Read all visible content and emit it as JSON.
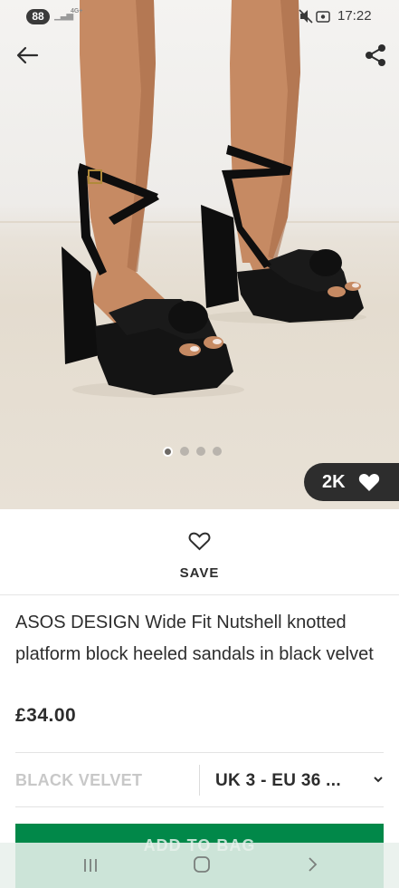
{
  "status_bar": {
    "battery_level": "88",
    "network_label": "4G+",
    "time": "17:22",
    "icons": [
      "signal-bars-icon",
      "mute-icon",
      "screen-record-icon"
    ]
  },
  "header": {
    "back_icon": "arrow-left-icon",
    "share_icon": "share-icon"
  },
  "gallery": {
    "image_count": 4,
    "active_index": 0
  },
  "likes": {
    "count": "2K",
    "icon": "heart-filled-icon"
  },
  "save": {
    "label": "SAVE",
    "icon": "heart-outline-icon"
  },
  "product": {
    "title": "ASOS DESIGN Wide Fit Nutshell knotted platform block heeled sandals in black velvet",
    "price": "£34.00",
    "colour": "BLACK VELVET",
    "size": "UK 3 - EU 36 ..."
  },
  "add_to_bag": {
    "label": "ADD TO BAG"
  },
  "colors": {
    "brand_green": "#018849",
    "text_dark": "#2d2d2d",
    "muted_grey": "#c8c8c8"
  },
  "system_nav": {
    "icons": [
      "recent-apps-icon",
      "home-icon",
      "back-chevron-icon"
    ]
  }
}
